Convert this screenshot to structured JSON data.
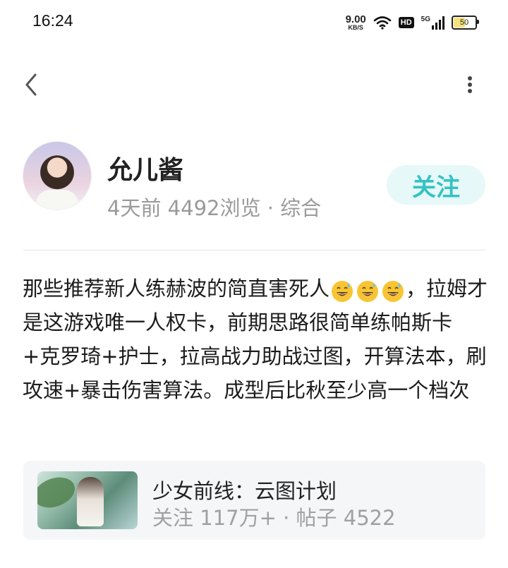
{
  "status_bar": {
    "time": "16:24",
    "net_speed_value": "9.00",
    "net_speed_unit": "KB/S",
    "hd_label": "HD",
    "signal_label": "5G",
    "battery": "50"
  },
  "icons": {
    "back": "chevron-left-icon",
    "more": "more-vertical-icon",
    "emoji": "grinning-sweat-emoji"
  },
  "author": {
    "name": "允儿酱",
    "meta": "4天前 4492浏览 · 综合",
    "follow_label": "关注"
  },
  "post": {
    "text_before_emoji": "那些推荐新人练赫波的简直害死人",
    "emoji_count": 3,
    "text_after_emoji": "，拉姆才是这游戏唯一人权卡，前期思路很简单练帕斯卡+克罗琦+护士，拉高战力助战过图，开算法本，刷攻速+暴击伤害算法。成型后比秋至少高一个档次"
  },
  "game_card": {
    "title": "少女前线：云图计划",
    "stats": "关注 117万+ · 帖子 4522"
  },
  "colors": {
    "accent": "#35c2c3",
    "follow_bg": "#e6f8f8",
    "meta_gray": "#9a9a9a",
    "card_bg": "#f5f6f8"
  }
}
